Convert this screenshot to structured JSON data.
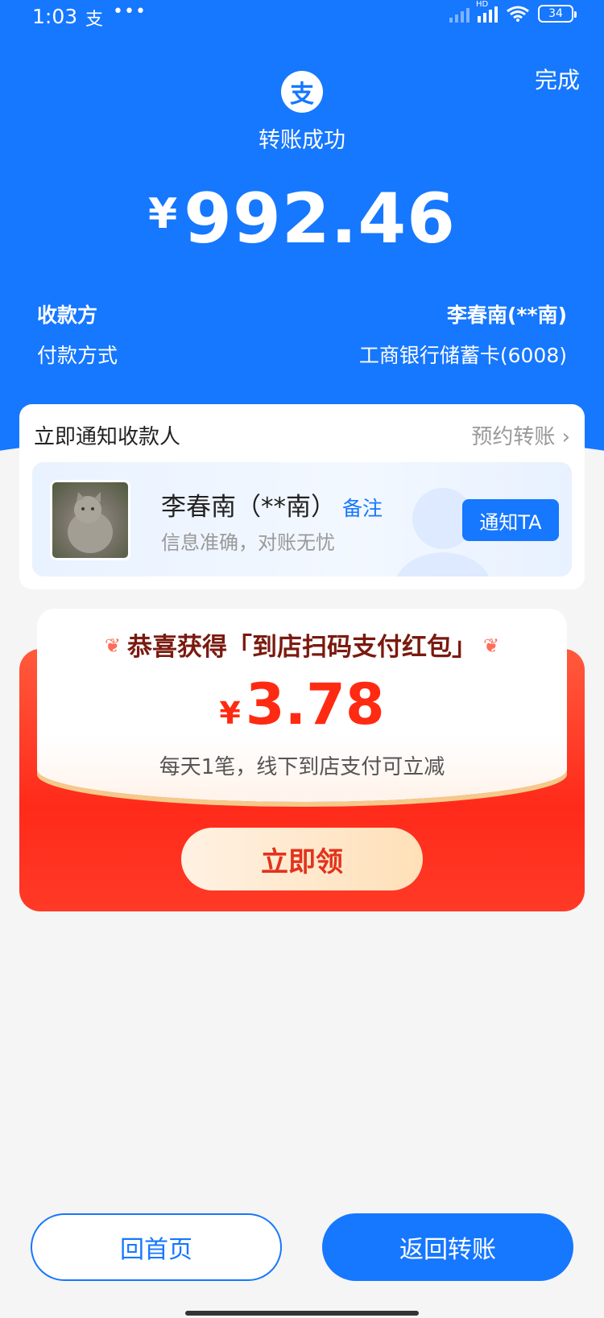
{
  "status_bar": {
    "time": "1:03",
    "app_icon_text": "支",
    "dots": "•••",
    "hd": "HD",
    "battery": "34"
  },
  "header": {
    "done_label": "完成",
    "logo_text": "支",
    "title": "转账成功",
    "currency_symbol": "¥",
    "amount": "992.46",
    "payee_label": "收款方",
    "payee_value": "李春南(**南)",
    "payment_method_label": "付款方式",
    "payment_method_value": "工商银行储蓄卡(6008)"
  },
  "notify_card": {
    "title": "立即通知收款人",
    "link_label": "预约转账",
    "name": "李春南（**南）",
    "remark_label": "备注",
    "subtitle": "信息准确，对账无忧",
    "notify_button": "通知TA"
  },
  "red_packet": {
    "title": "恭喜获得「到店扫码支付红包」",
    "currency_symbol": "¥",
    "amount": "3.78",
    "description": "每天1笔，线下到店支付可立减",
    "claim_button": "立即领"
  },
  "bottom": {
    "home_button": "回首页",
    "back_button": "返回转账"
  },
  "colors": {
    "primary": "#1677ff",
    "red": "#ff2a12"
  }
}
